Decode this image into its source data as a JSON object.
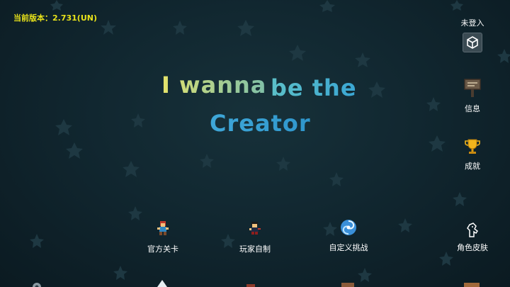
{
  "version_label": "当前版本：2.731(UN)",
  "title": {
    "line1_a": "I wanna",
    "line1_b": "be the",
    "line2": "Creator"
  },
  "side_menu": {
    "login_label": "未登入",
    "info_label": "信息",
    "achievements_label": "成就",
    "skins_label": "角色皮肤"
  },
  "bottom_menu": {
    "official_levels": "官方关卡",
    "player_made": "玩家自制",
    "custom_challenge": "自定义挑战"
  },
  "colors": {
    "version_text": "#e8e21a",
    "background": "#112730",
    "star": "#1f3a44"
  },
  "icons": [
    "unity-logo-icon",
    "signboard-icon",
    "trophy-icon",
    "character-icon",
    "vortex-icon",
    "kid-icon",
    "skin-icon"
  ]
}
